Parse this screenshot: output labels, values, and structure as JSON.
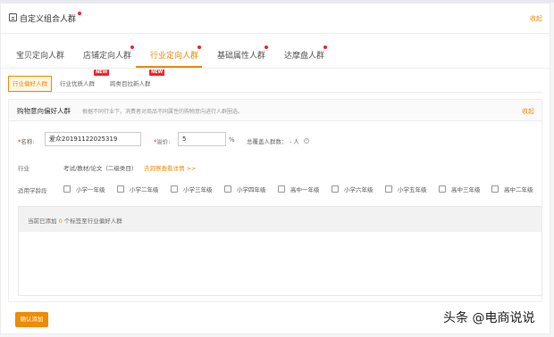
{
  "header": {
    "title": "自定义组合人群",
    "collapse_label": "收起"
  },
  "tabs": [
    {
      "label": "宝贝定向人群",
      "has_dot": false
    },
    {
      "label": "店铺定向人群",
      "has_dot": true
    },
    {
      "label": "行业定向人群",
      "has_dot": true,
      "active": true
    },
    {
      "label": "基础属性人群",
      "has_dot": true
    },
    {
      "label": "达摩盘人群",
      "has_dot": true
    }
  ],
  "subtabs": [
    {
      "label": "行业偏好人群",
      "active": true,
      "badge": ""
    },
    {
      "label": "行业优质人群",
      "active": false,
      "badge": "NEW"
    },
    {
      "label": "跨类目拉新人群",
      "active": false,
      "badge": "NEW"
    }
  ],
  "panel": {
    "title": "购物意向偏好人群",
    "description": "根据不同行业下，消费者对商品不同属性的购物意向进行人群圈选。",
    "collapse_label": "收起"
  },
  "form": {
    "name_label": "名称:",
    "name_value": "爱众20191122025319",
    "premium_label": "溢价:",
    "premium_value": "5",
    "premium_unit": "%",
    "audience_label": "总覆盖人群数：",
    "audience_value": "- 人",
    "industry_label": "行业",
    "industry_value": "考试/教材/论文（二级类目）",
    "industry_link": "去洞察查看详情 >>",
    "grade_label": "适用学龄段",
    "grades": [
      "小学一年级",
      "小学二年级",
      "小学三年级",
      "小学四年级",
      "高中一年级",
      "小学六年级",
      "小学五年级",
      "高中三年级",
      "高中二年级"
    ]
  },
  "added": {
    "prefix": "当前已添加",
    "count": "0",
    "suffix": "个标签至行业偏好人群"
  },
  "confirm_label": "确认添加",
  "watermark": "头条 @电商说说",
  "colors": {
    "accent": "#f08a00",
    "dot": "#f5222d"
  }
}
